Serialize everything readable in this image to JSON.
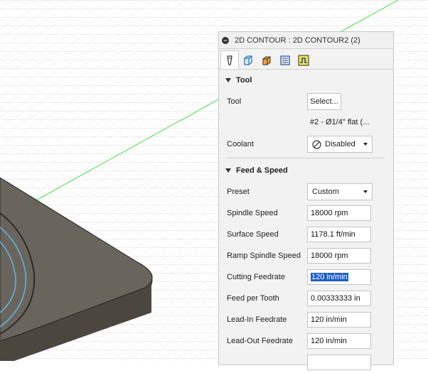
{
  "panel": {
    "title": "2D CONTOUR : 2D CONTOUR2 (2)",
    "tabs": [
      {
        "icon": "tool-icon",
        "active": true
      },
      {
        "icon": "geometry-icon",
        "active": false
      },
      {
        "icon": "heights-icon",
        "active": false
      },
      {
        "icon": "passes-icon",
        "active": false
      },
      {
        "icon": "linking-icon",
        "active": false
      }
    ],
    "tool_section": {
      "header": "Tool",
      "tool_label": "Tool",
      "tool_button": "Select...",
      "tool_description": "#2 - Ø1/4\" flat (...",
      "coolant_label": "Coolant",
      "coolant_value": "Disabled"
    },
    "feed_section": {
      "header": "Feed & Speed",
      "preset_label": "Preset",
      "preset_value": "Custom",
      "fields": [
        {
          "label": "Spindle Speed",
          "value": "18000 rpm"
        },
        {
          "label": "Surface Speed",
          "value": "1178.1 ft/min"
        },
        {
          "label": "Ramp Spindle Speed",
          "value": "18000 rpm"
        },
        {
          "label": "Cutting Feedrate",
          "value": "120 in/min"
        },
        {
          "label": "Feed per Tooth",
          "value": "0.00333333 in"
        },
        {
          "label": "Lead-In Feedrate",
          "value": "120 in/min"
        },
        {
          "label": "Lead-Out Feedrate",
          "value": "120 in/min"
        }
      ]
    }
  },
  "colors": {
    "panel_bg": "#f2f2f2",
    "grid_line": "#d9d9d9",
    "axis_green": "#3ddc3d",
    "part_top": "#6b665d",
    "part_side": "#4a463f",
    "selection_highlight": "#1c5fc6"
  }
}
